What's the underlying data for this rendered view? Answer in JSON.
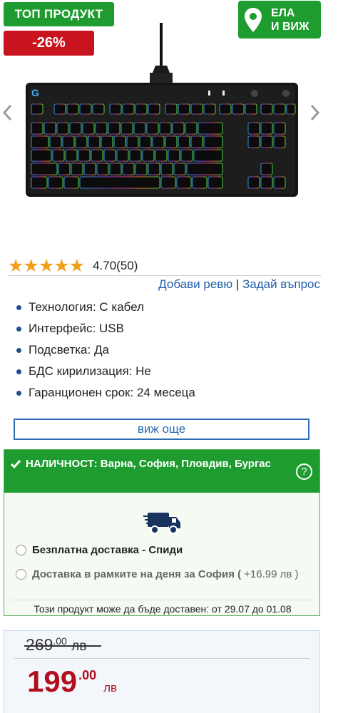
{
  "badges": {
    "top_product": "ТОП ПРОДУКТ",
    "discount": "-26%",
    "come_see_line1": "ЕЛА",
    "come_see_line2": "И ВИЖ"
  },
  "icons": {
    "gallery_prev": "chevron-left-icon",
    "gallery_next": "chevron-right-icon",
    "location": "map-pin-icon",
    "availability": "check-icon",
    "help": "question-icon",
    "delivery": "truck-icon"
  },
  "rating": {
    "stars": "★★★★★",
    "value": "4.70(50)"
  },
  "review_links": {
    "add_review": "Добави ревю",
    "separator": "|",
    "ask_question": "Задай въпрос"
  },
  "specs": [
    "Технология: С кабел",
    "Интерфейс: USB",
    "Подсветка: Да",
    "БДС кирилизация: Не",
    "Гаранционен срок: 24 месеца"
  ],
  "see_more": "виж още",
  "availability": {
    "text": "НАЛИЧНОСТ: Варна, София, Пловдив, Бургас",
    "help": "?",
    "option1": "Безплатна доставка - Спиди",
    "option2": "Доставка в рамките на деня за София (",
    "option2_extra": "+16.99 лв )",
    "note": "Този продукт може да бъде доставен: от 29.07 до 01.08"
  },
  "price": {
    "old_main": "269",
    "old_dec": ".00",
    "old_currency": "лв",
    "new_main": "199",
    "new_dec": ".00",
    "new_currency": "лв"
  },
  "colors": {
    "green": "#1e9c2f",
    "red": "#c8141e",
    "blue_link": "#1f5fa8",
    "price_red": "#b0101c",
    "star": "#f0a11c"
  }
}
